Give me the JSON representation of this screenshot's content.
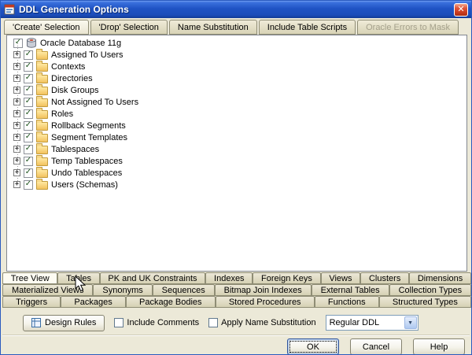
{
  "window": {
    "title": "DDL Generation Options"
  },
  "icons": {
    "expand": "+",
    "check": "✓",
    "close": "✕",
    "dropdown_arrow": "▼"
  },
  "top_tabs": [
    {
      "label": "'Create' Selection",
      "active": true
    },
    {
      "label": "'Drop' Selection"
    },
    {
      "label": "Name Substitution"
    },
    {
      "label": "Include Table Scripts"
    },
    {
      "label": "Oracle Errors to Mask",
      "disabled": true
    }
  ],
  "tree": {
    "root": "Oracle Database 11g",
    "items": [
      "Assigned To Users",
      "Contexts",
      "Directories",
      "Disk Groups",
      "Not Assigned To Users",
      "Roles",
      "Rollback Segments",
      "Segment Templates",
      "Tablespaces",
      "Temp Tablespaces",
      "Undo Tablespaces",
      "Users (Schemas)"
    ]
  },
  "bottom_tabs": {
    "row1": [
      {
        "label": "Tree View",
        "active": true
      },
      {
        "label": "Tables"
      },
      {
        "label": "PK and UK Constraints"
      },
      {
        "label": "Indexes"
      },
      {
        "label": "Foreign Keys"
      },
      {
        "label": "Views"
      },
      {
        "label": "Clusters"
      },
      {
        "label": "Dimensions"
      }
    ],
    "row2": [
      {
        "label": "Materialized Views"
      },
      {
        "label": "Synonyms"
      },
      {
        "label": "Sequences"
      },
      {
        "label": "Bitmap Join Indexes"
      },
      {
        "label": "External Tables"
      },
      {
        "label": "Collection Types"
      }
    ],
    "row3": [
      {
        "label": "Triggers"
      },
      {
        "label": "Packages"
      },
      {
        "label": "Package Bodies"
      },
      {
        "label": "Stored Procedures"
      },
      {
        "label": "Functions"
      },
      {
        "label": "Structured Types"
      }
    ]
  },
  "footer": {
    "design_rules_label": "Design Rules",
    "include_comments_label": "Include Comments",
    "apply_name_substitution_label": "Apply Name Substitution",
    "ddl_type_value": "Regular DDL"
  },
  "action_buttons": {
    "ok": "OK",
    "cancel": "Cancel",
    "help": "Help"
  }
}
